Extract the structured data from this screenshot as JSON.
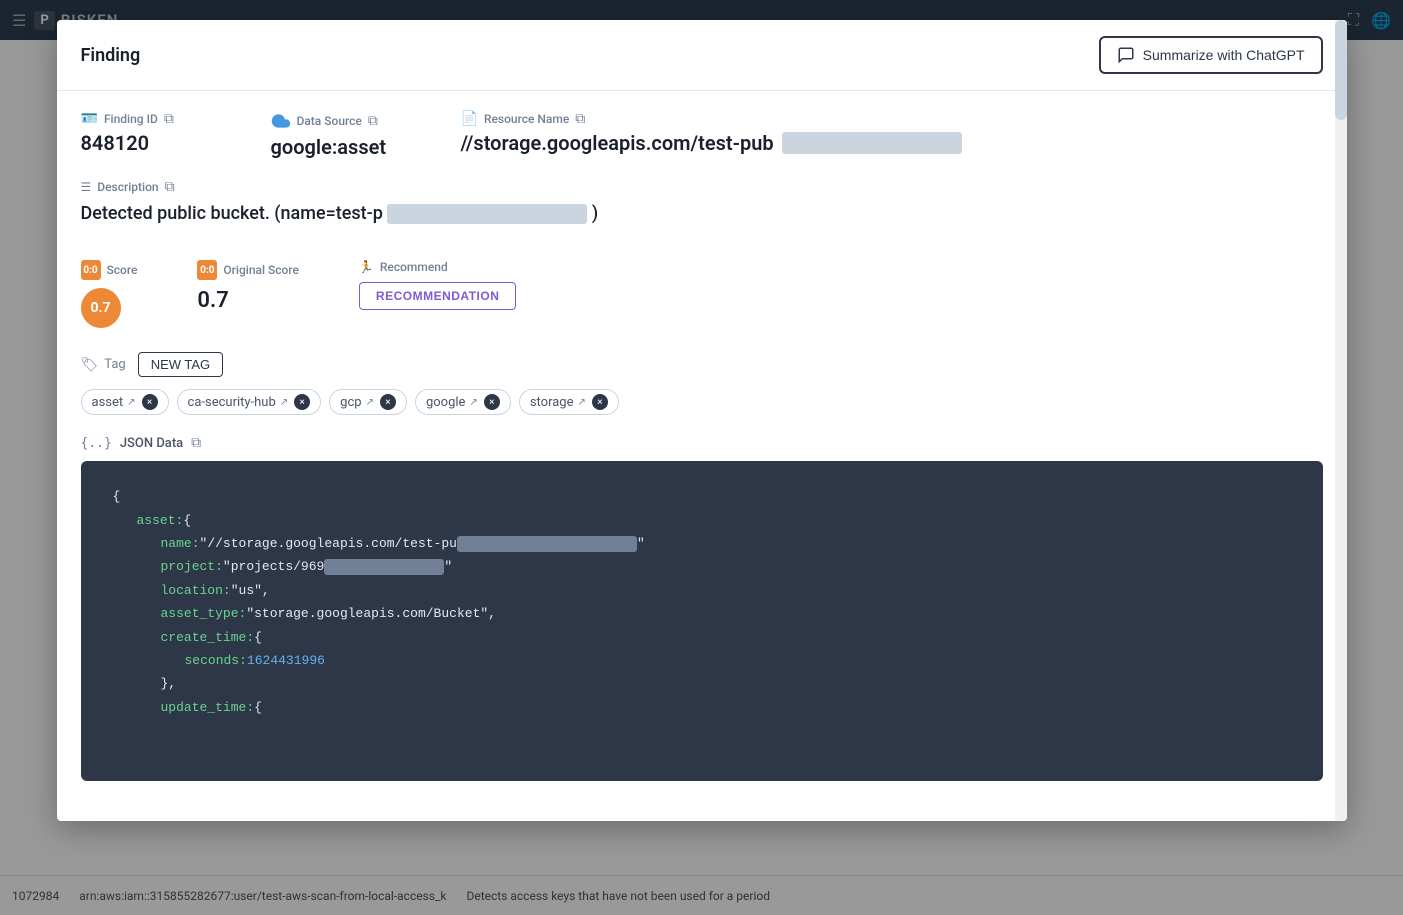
{
  "navbar": {
    "menu_icon": "☰",
    "logo_box": "P",
    "logo_text": "RISKEN",
    "expand_icon": "⛶",
    "globe_icon": "🌐"
  },
  "modal": {
    "title": "Finding",
    "summarize_btn": "Summarize with ChatGPT",
    "finding_id_label": "Finding ID",
    "finding_id_value": "848120",
    "data_source_label": "Data Source",
    "data_source_value": "google:asset",
    "resource_name_label": "Resource Name",
    "resource_name_value": "//storage.googleapis.com/test-pub",
    "description_label": "Description",
    "description_value": "Detected public bucket. (name=test-p",
    "score_label": "Score",
    "score_value": "0.7",
    "original_score_label": "Original Score",
    "original_score_value": "0.7",
    "recommend_label": "Recommend",
    "recommendation_btn": "RECOMMENDATION",
    "tag_label": "Tag",
    "new_tag_btn": "NEW TAG",
    "tags": [
      {
        "name": "asset"
      },
      {
        "name": "ca-security-hub"
      },
      {
        "name": "gcp"
      },
      {
        "name": "google"
      },
      {
        "name": "storage"
      }
    ],
    "json_data_label": "JSON Data",
    "json_content": {
      "brace_open": "{",
      "key_asset": "asset:",
      "brace_open2": "{",
      "key_name": "name:",
      "val_name": "\"//storage.googleapis.com/test-pu",
      "key_project": "project:",
      "val_project": "\"projects/969",
      "key_location": "location:",
      "val_location": "\"us\",",
      "key_asset_type": "asset_type:",
      "val_asset_type": "\"storage.googleapis.com/Bucket\",",
      "key_create_time": "create_time:",
      "brace_open3": "{",
      "key_seconds": "seconds:",
      "val_seconds": "1624431996",
      "brace_close3": "},",
      "key_update_time": "update_time:",
      "brace_open4": "{"
    }
  },
  "bottom_row": {
    "id": "1072984",
    "resource_partial": "arn:aws:iam::315855282677:user/test-aws-scan-from-local-access_k",
    "description_partial": "Detects access keys that have not been used for a period"
  }
}
